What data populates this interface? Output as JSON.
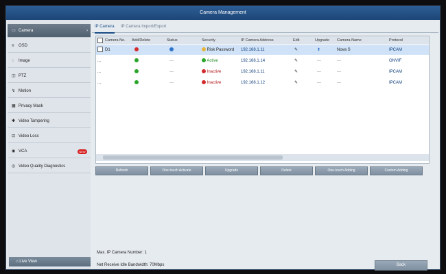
{
  "window": {
    "title": "Camera Management"
  },
  "sidebar": {
    "items": [
      {
        "label": "Camera",
        "icon": "camera-icon"
      },
      {
        "label": "OSD",
        "icon": "osd-icon"
      },
      {
        "label": "Image",
        "icon": "image-icon"
      },
      {
        "label": "PTZ",
        "icon": "ptz-icon"
      },
      {
        "label": "Motion",
        "icon": "motion-icon"
      },
      {
        "label": "Privacy Mask",
        "icon": "privacy-mask-icon"
      },
      {
        "label": "Video Tampering",
        "icon": "tampering-icon"
      },
      {
        "label": "Video Loss",
        "icon": "video-loss-icon"
      },
      {
        "label": "VCA",
        "icon": "vca-icon",
        "badge": "NEW"
      },
      {
        "label": "Video Quality Diagnostics",
        "icon": "diagnostics-icon"
      }
    ],
    "live_view": "Live View"
  },
  "tabs": [
    {
      "label": "IP Camera"
    },
    {
      "label": "IP Camera Import/Export"
    }
  ],
  "table": {
    "headers": [
      "Camera No.",
      "Add/Delete",
      "Status",
      "Security",
      "IP Camera Address",
      "Edit",
      "Upgrade",
      "Camera Name",
      "Protocol"
    ],
    "rows": [
      {
        "camera_no": "D1",
        "status": "—",
        "security": "Risk Password",
        "ip": "192.168.1.11",
        "camera_name": "Nova S",
        "protocol": "IPCAM"
      },
      {
        "camera_no": "...",
        "status": "—",
        "security": "Active",
        "ip": "192.168.1.14",
        "camera_name": "—",
        "protocol": "ONVIF"
      },
      {
        "camera_no": "...",
        "status": "—",
        "security": "Inactive",
        "ip": "192.168.1.11",
        "camera_name": "—",
        "protocol": "IPCAM"
      },
      {
        "camera_no": "...",
        "status": "—",
        "security": "Inactive",
        "ip": "192.168.1.12",
        "camera_name": "—",
        "protocol": "IPCAM"
      }
    ]
  },
  "buttons": [
    {
      "label": "Refresh"
    },
    {
      "label": "One-touch Activate"
    },
    {
      "label": "Upgrade"
    },
    {
      "label": "Delete"
    },
    {
      "label": "One-touch Adding"
    },
    {
      "label": "Custom Adding"
    }
  ],
  "info": {
    "max_cameras": "Max. IP Camera Number: 1",
    "bandwidth": "Net Receive Idle Bandwidth: 70Mbps"
  },
  "back": "Back"
}
